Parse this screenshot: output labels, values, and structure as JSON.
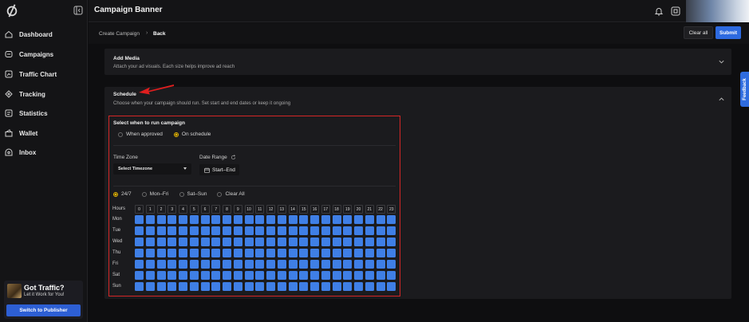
{
  "sidebar": {
    "items": [
      {
        "label": "Dashboard",
        "icon": "home-icon"
      },
      {
        "label": "Campaigns",
        "icon": "campaigns-icon"
      },
      {
        "label": "Traffic Chart",
        "icon": "chart-icon"
      },
      {
        "label": "Tracking",
        "icon": "tracking-icon"
      },
      {
        "label": "Statistics",
        "icon": "statistics-icon"
      },
      {
        "label": "Wallet",
        "icon": "wallet-icon"
      },
      {
        "label": "Inbox",
        "icon": "inbox-icon"
      }
    ],
    "promo": {
      "title": "Got Traffic?",
      "subtitle": "Let it Work for You!",
      "button": "Switch to Publisher"
    }
  },
  "header": {
    "title": "Campaign Banner"
  },
  "breadcrumb": {
    "create": "Create Campaign",
    "separator": "›",
    "back": "Back"
  },
  "actions": {
    "clear_all": "Clear all",
    "submit": "Submit"
  },
  "feedback": {
    "label": "Feedback"
  },
  "add_media": {
    "title": "Add Media",
    "subtitle": "Attach your ad visuals. Each size helps improve ad reach"
  },
  "schedule": {
    "title": "Schedule",
    "subtitle": "Choose when your campaign should run. Set start and end dates or keep it ongoing",
    "run_label": "Select when to run campaign",
    "run_options": [
      "When approved",
      "On schedule"
    ],
    "run_selected": "On schedule",
    "timezone_label": "Time Zone",
    "timezone_value": "Select Timezone",
    "date_range_label": "Date Range",
    "date_range_value": "Start–End",
    "presets": [
      "24/7",
      "Mon–Fri",
      "Sat–Sun",
      "Clear All"
    ],
    "preset_selected": "24/7",
    "hours_label": "Hours",
    "hours": [
      "0",
      "1",
      "2",
      "3",
      "4",
      "5",
      "6",
      "7",
      "8",
      "9",
      "10",
      "11",
      "12",
      "13",
      "14",
      "15",
      "16",
      "17",
      "18",
      "19",
      "20",
      "21",
      "22",
      "23"
    ],
    "days": [
      "Mon",
      "Tue",
      "Wed",
      "Thu",
      "Fri",
      "Sat",
      "Sun"
    ],
    "all_selected": true
  },
  "colors": {
    "accent": "#2d6ae0",
    "grid_cell": "#3f7fe6",
    "highlight_border": "#d42626",
    "radio_on": "#e4b400"
  }
}
